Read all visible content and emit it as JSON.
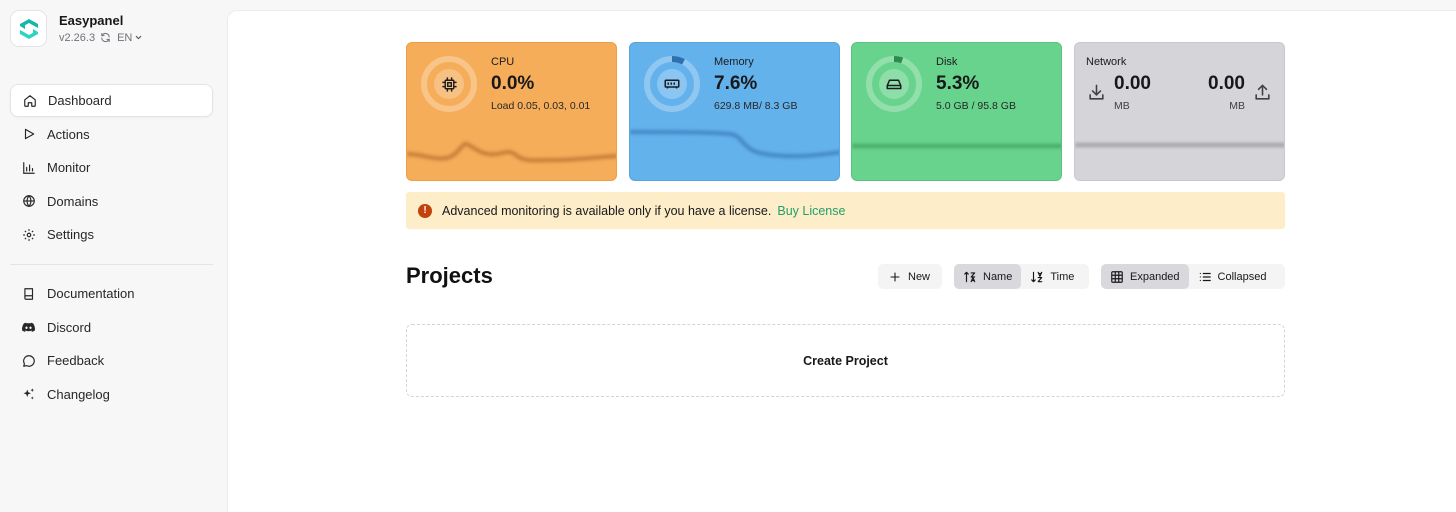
{
  "app": {
    "name": "Easypanel",
    "version": "v2.26.3",
    "language": "EN"
  },
  "nav": {
    "primary": [
      {
        "label": "Dashboard",
        "icon": "home-icon",
        "active": true
      },
      {
        "label": "Actions",
        "icon": "play-icon"
      },
      {
        "label": "Monitor",
        "icon": "bar-chart-icon"
      },
      {
        "label": "Domains",
        "icon": "globe-icon"
      },
      {
        "label": "Settings",
        "icon": "gear-icon"
      }
    ],
    "secondary": [
      {
        "label": "Documentation",
        "icon": "book-icon"
      },
      {
        "label": "Discord",
        "icon": "discord-icon"
      },
      {
        "label": "Feedback",
        "icon": "chat-bubble-icon"
      },
      {
        "label": "Changelog",
        "icon": "sparkles-icon"
      }
    ]
  },
  "stats": {
    "cpu": {
      "title": "CPU",
      "value": "0.0%",
      "sub": "Load 0.05, 0.03, 0.01",
      "percent": 0.0,
      "color": "#f5ad5a"
    },
    "memory": {
      "title": "Memory",
      "value": "7.6%",
      "sub": "629.8 MB/ 8.3 GB",
      "percent": 7.6,
      "color": "#64b2ec"
    },
    "disk": {
      "title": "Disk",
      "value": "5.3%",
      "sub": "5.0 GB / 95.8 GB",
      "percent": 5.3,
      "color": "#68d38c"
    },
    "network": {
      "title": "Network",
      "download_value": "0.00",
      "download_unit": "MB",
      "upload_value": "0.00",
      "upload_unit": "MB",
      "color": "#d5d5d9"
    }
  },
  "alert": {
    "message": "Advanced monitoring is available only if you have a license.",
    "link": "Buy License"
  },
  "projects": {
    "title": "Projects",
    "new_label": "New",
    "sort": {
      "name_label": "Name",
      "time_label": "Time",
      "selected": "Name"
    },
    "view": {
      "expanded_label": "Expanded",
      "collapsed_label": "Collapsed",
      "selected": "Expanded"
    },
    "create_label": "Create Project"
  }
}
